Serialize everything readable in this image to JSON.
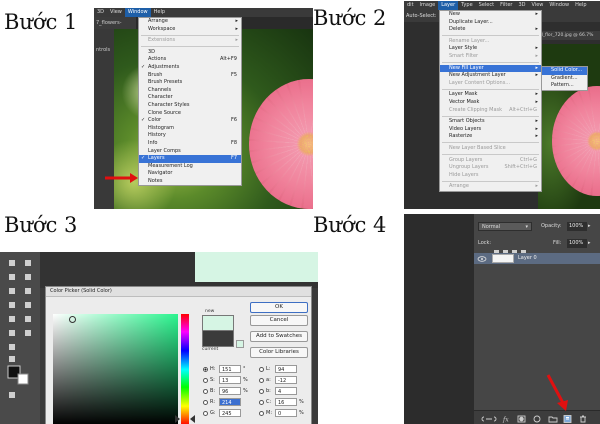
{
  "labels": {
    "step1": "Bước 1",
    "step2": "Bước 2",
    "step3": "Bước 3",
    "step4": "Bước 4"
  },
  "step1": {
    "menubar": [
      "3D",
      "View",
      "Window",
      "Help"
    ],
    "active_menu": "Window",
    "doc_tab": "7_flowers-59734",
    "tool_label": "ntrols",
    "menu_items": [
      {
        "label": "Arrange",
        "arrow": true
      },
      {
        "label": "Workspace",
        "arrow": true
      },
      {
        "sep": true
      },
      {
        "label": "Extensions",
        "disabled": true,
        "arrow": true
      },
      {
        "sep": true
      },
      {
        "label": "3D"
      },
      {
        "label": "Actions",
        "shortcut": "Alt+F9"
      },
      {
        "label": "Adjustments",
        "check": true
      },
      {
        "label": "Brush",
        "shortcut": "F5"
      },
      {
        "label": "Brush Presets"
      },
      {
        "label": "Channels"
      },
      {
        "label": "Character"
      },
      {
        "label": "Character Styles"
      },
      {
        "label": "Clone Source"
      },
      {
        "label": "Color",
        "check": true,
        "shortcut": "F6"
      },
      {
        "label": "Histogram"
      },
      {
        "label": "History"
      },
      {
        "label": "Info",
        "shortcut": "F8"
      },
      {
        "label": "Layer Comps"
      },
      {
        "label": "Layers",
        "check": true,
        "shortcut": "F7",
        "highlight": true
      },
      {
        "label": "Measurement Log"
      },
      {
        "label": "Navigator"
      },
      {
        "label": "Notes"
      }
    ]
  },
  "step2": {
    "menubar": [
      "dit",
      "Image",
      "Layer",
      "Type",
      "Select",
      "Filter",
      "3D",
      "View",
      "Window",
      "Help"
    ],
    "active_menu": "Layer",
    "auto_select": "Auto-Select:",
    "doc_tab": "fl_flor_720.jpg @ 66.7%",
    "menu_items": [
      {
        "label": "New",
        "arrow": true
      },
      {
        "label": "Duplicate Layer..."
      },
      {
        "label": "Delete",
        "arrow": true
      },
      {
        "sep": true
      },
      {
        "label": "Rename Layer...",
        "disabled": true
      },
      {
        "label": "Layer Style",
        "arrow": true
      },
      {
        "label": "Smart Filter",
        "disabled": true,
        "arrow": true
      },
      {
        "sep": true
      },
      {
        "label": "New Fill Layer",
        "arrow": true,
        "highlight": true
      },
      {
        "label": "New Adjustment Layer",
        "arrow": true
      },
      {
        "label": "Layer Content Options...",
        "disabled": true
      },
      {
        "sep": true
      },
      {
        "label": "Layer Mask",
        "arrow": true
      },
      {
        "label": "Vector Mask",
        "arrow": true
      },
      {
        "label": "Create Clipping Mask",
        "shortcut": "Alt+Ctrl+G",
        "disabled": true
      },
      {
        "sep": true
      },
      {
        "label": "Smart Objects",
        "arrow": true
      },
      {
        "label": "Video Layers",
        "arrow": true
      },
      {
        "label": "Rasterize",
        "arrow": true
      },
      {
        "sep": true
      },
      {
        "label": "New Layer Based Slice",
        "disabled": true
      },
      {
        "sep": true
      },
      {
        "label": "Group Layers",
        "shortcut": "Ctrl+G",
        "disabled": true
      },
      {
        "label": "Ungroup Layers",
        "shortcut": "Shift+Ctrl+G",
        "disabled": true
      },
      {
        "label": "Hide Layers",
        "disabled": true
      },
      {
        "sep": true
      },
      {
        "label": "Arrange",
        "arrow": true,
        "disabled": true
      }
    ],
    "submenu": [
      {
        "label": "Solid Color...",
        "highlight": true
      },
      {
        "label": "Gradient..."
      },
      {
        "label": "Pattern..."
      }
    ]
  },
  "step3": {
    "dialog_title": "Color Picker (Solid Color)",
    "buttons": {
      "ok": "OK",
      "cancel": "Cancel",
      "add": "Add to Swatches",
      "libraries": "Color Libraries"
    },
    "new_label": "new",
    "current_label": "current",
    "fields": [
      {
        "label": "H:",
        "value": "151",
        "unit": "°",
        "selected": true
      },
      {
        "label": "S:",
        "value": "13",
        "unit": "%"
      },
      {
        "label": "B:",
        "value": "96",
        "unit": "%"
      },
      {
        "label": "R:",
        "value": "214",
        "unit": ""
      },
      {
        "label": "G:",
        "value": "245",
        "unit": ""
      }
    ],
    "lab_fields": [
      {
        "label": "L:",
        "value": "94"
      },
      {
        "label": "a:",
        "value": "-12"
      },
      {
        "label": "b:",
        "value": "4"
      },
      {
        "label": "C:",
        "value": "16",
        "unit": "%"
      },
      {
        "label": "M:",
        "value": "0",
        "unit": "%"
      }
    ],
    "new_color": "#d6f5e4"
  },
  "step4": {
    "blend_mode": "Normal",
    "opacity_label": "Opacity:",
    "opacity_value": "100%",
    "lock_label": "Lock:",
    "fill_label": "Fill:",
    "fill_value": "100%",
    "layer_name": "Layer 0",
    "bottom_icons": [
      "link-icon",
      "fx-icon",
      "mask-icon",
      "adjustment-icon",
      "folder-icon",
      "new-layer-icon",
      "trash-icon"
    ]
  }
}
